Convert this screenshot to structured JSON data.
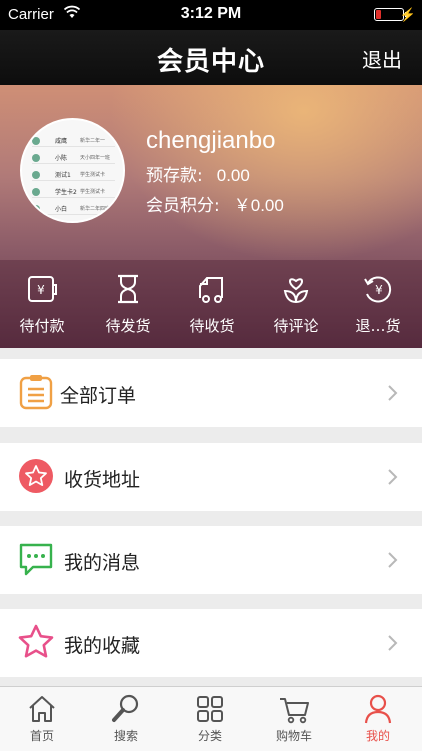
{
  "status_bar": {
    "carrier": "Carrier",
    "time": "3:12 PM",
    "battery_level": 0.2
  },
  "nav": {
    "title": "会员中心",
    "logout": "退出"
  },
  "profile": {
    "username": "chengjianbo",
    "deposit_label": "预存款:",
    "deposit_value": "0.00",
    "points_label": "会员积分:",
    "points_value": "￥0.00",
    "avatar_rows": [
      {
        "name": "咸鹰",
        "desc": "新华二年一"
      },
      {
        "name": "小陈",
        "desc": "天小四年一班"
      },
      {
        "name": "测试1",
        "desc": "学生测试卡"
      },
      {
        "name": "学生卡2",
        "desc": "学生测试卡"
      },
      {
        "name": "小白",
        "desc": "新华二年四班"
      }
    ]
  },
  "orders": [
    {
      "label": "待付款",
      "icon": "wallet-icon"
    },
    {
      "label": "待发货",
      "icon": "hourglass-icon"
    },
    {
      "label": "待收货",
      "icon": "truck-icon"
    },
    {
      "label": "待评论",
      "icon": "heart-flower-icon"
    },
    {
      "label": "退…货",
      "icon": "refund-icon"
    }
  ],
  "menu": [
    {
      "label": "全部订单",
      "icon": "clipboard-icon",
      "color": "#f0a044"
    },
    {
      "label": "收货地址",
      "icon": "star-circle-icon",
      "color": "#ee5a63"
    },
    {
      "label": "我的消息",
      "icon": "chat-icon",
      "color": "#37b24d"
    },
    {
      "label": "我的收藏",
      "icon": "star-outline-icon",
      "color": "#e8508a"
    }
  ],
  "tabs": [
    {
      "label": "首页",
      "icon": "home-icon"
    },
    {
      "label": "搜索",
      "icon": "search-icon"
    },
    {
      "label": "分类",
      "icon": "category-icon"
    },
    {
      "label": "购物车",
      "icon": "cart-icon"
    },
    {
      "label": "我的",
      "icon": "user-icon",
      "active": true
    }
  ],
  "colors": {
    "active_tab": "#e8504a",
    "nav_bg": "#111111"
  }
}
